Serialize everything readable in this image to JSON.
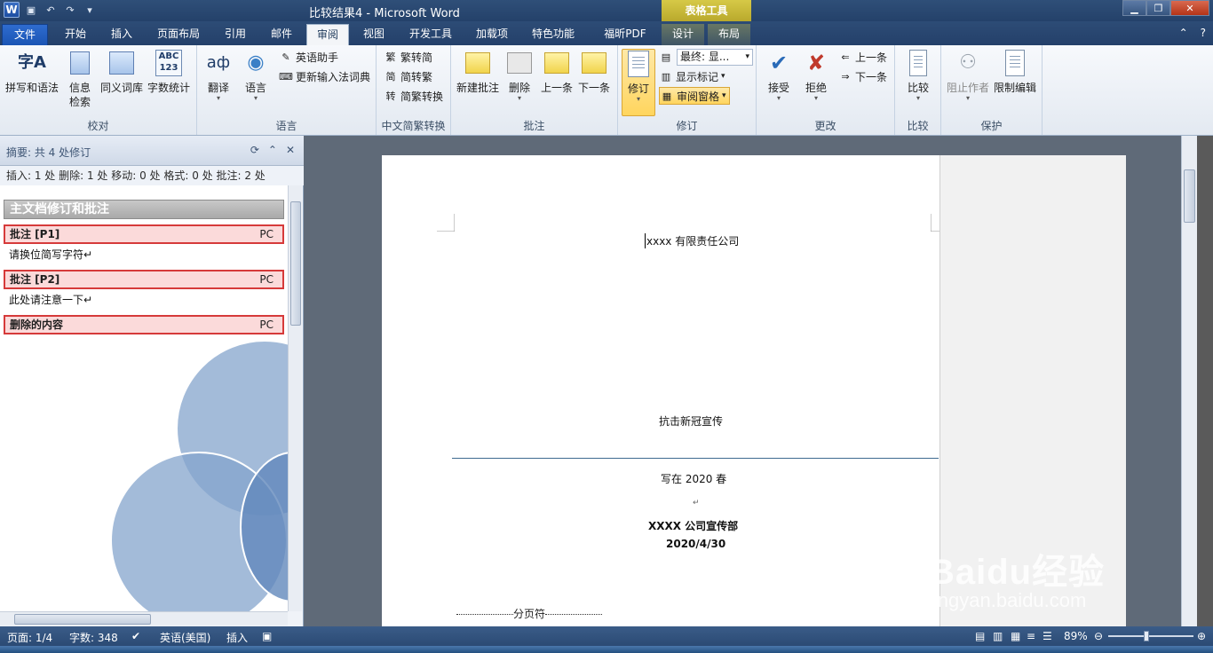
{
  "window": {
    "title": "比较结果4 - Microsoft Word",
    "context_tab_group": "表格工具",
    "qat": [
      "save-icon",
      "undo-icon",
      "redo-icon",
      "customize-icon"
    ]
  },
  "tabs": [
    {
      "label": "文件",
      "kind": "file"
    },
    {
      "label": "开始"
    },
    {
      "label": "插入"
    },
    {
      "label": "页面布局"
    },
    {
      "label": "引用"
    },
    {
      "label": "邮件"
    },
    {
      "label": "审阅",
      "active": true
    },
    {
      "label": "视图"
    },
    {
      "label": "开发工具"
    },
    {
      "label": "加载项"
    },
    {
      "label": "特色功能"
    },
    {
      "label": "福昕PDF"
    },
    {
      "label": "设计",
      "context": true
    },
    {
      "label": "布局",
      "context": true
    }
  ],
  "ribbon": {
    "groups": {
      "proofing": "校对",
      "language": "语言",
      "chinese_conversion": "中文简繁转换",
      "comments": "批注",
      "tracking": "修订",
      "changes": "更改",
      "compare": "比较",
      "protect": "保护"
    },
    "buttons": {
      "spelling": "拼写和语法",
      "research_line1": "信息",
      "research_line2": "检索",
      "thesaurus": "同义词库",
      "word_count": "字数统计",
      "translate": "翻译",
      "language": "语言",
      "english_assistant": "英语助手",
      "update_ime": "更新输入法词典",
      "trad_to_simp": "繁转简",
      "simp_to_trad": "简转繁",
      "convert": "简繁转换",
      "new_comment": "新建批注",
      "delete": "删除",
      "prev_comment": "上一条",
      "next_comment": "下一条",
      "track_changes": "修订",
      "display_mode": "最终: 显...",
      "show_markup": "显示标记",
      "reviewing_pane": "审阅窗格",
      "accept": "接受",
      "reject": "拒绝",
      "prev_change": "上一条",
      "next_change": "下一条",
      "compare": "比较",
      "block_authors": "阻止作者",
      "restrict_editing": "限制编辑"
    },
    "accent": "#ffd55e"
  },
  "reviewing_pane": {
    "header": "摘要: 共 4 处修订",
    "stats": "插入: 1 处  删除: 1 处  移动: 0 处  格式: 0 处  批注: 2 处",
    "section_title": "主文档修订和批注",
    "items": [
      {
        "label": "批注  [P1]",
        "author": "PC",
        "text": "请换位简写字符↵"
      },
      {
        "label": "批注  [P2]",
        "author": "PC",
        "text": "此处请注意一下↵"
      },
      {
        "label": "删除的内容",
        "author": "PC",
        "text": ""
      }
    ]
  },
  "document": {
    "company": "xxxx 有限责任公司",
    "headline": "抗击新冠宣传",
    "written": "写在 2020 春",
    "department": "XXXX 公司宣传部",
    "date": "2020/4/30",
    "page_break": "分页符",
    "para_mark": "↵"
  },
  "statusbar": {
    "page": "页面: 1/4",
    "words": "字数: 348",
    "language": "英语(美国)",
    "mode": "插入",
    "zoom": "89%",
    "zoom_fraction": 0.42
  },
  "watermark": {
    "brand": "Baidu经验",
    "url": "jingyan.baidu.com"
  }
}
